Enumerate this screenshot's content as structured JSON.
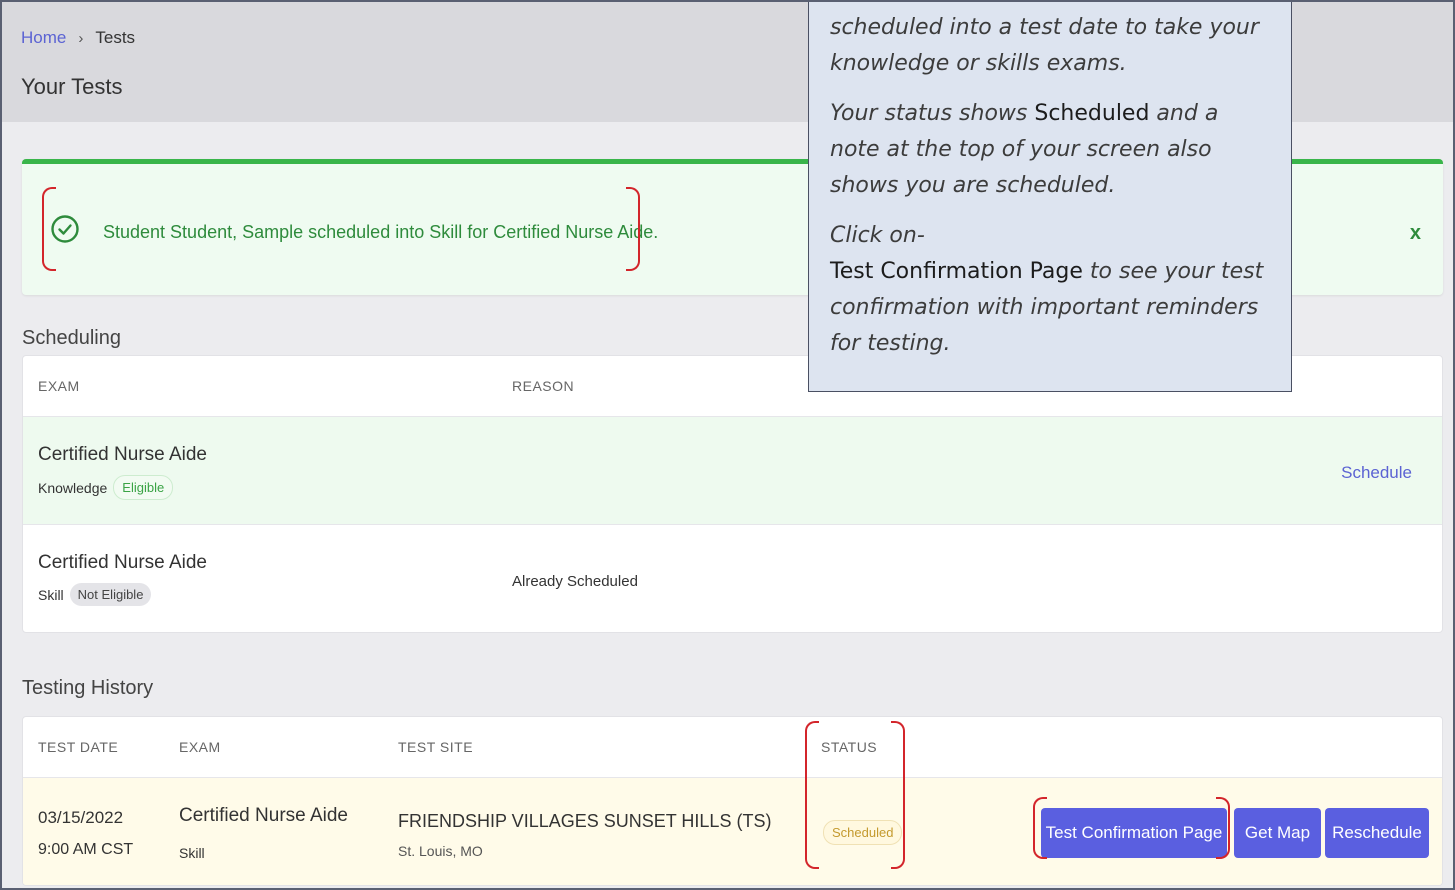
{
  "breadcrumb": {
    "home": "Home",
    "separator": "›",
    "current": "Tests"
  },
  "page_title": "Your Tests",
  "alert": {
    "message": "Student Student, Sample scheduled into Skill for Certified Nurse Aide.",
    "close": "x",
    "icon": "check-circle-icon",
    "color": "#39b54a"
  },
  "scheduling": {
    "label": "Scheduling",
    "headers": {
      "exam": "EXAM",
      "reason": "REASON"
    },
    "rows": [
      {
        "exam": "Certified Nurse Aide",
        "type": "Knowledge",
        "badge": "Eligible",
        "reason": "",
        "action": "Schedule"
      },
      {
        "exam": "Certified Nurse Aide",
        "type": "Skill",
        "badge": "Not Eligible",
        "reason": "Already Scheduled",
        "action": ""
      }
    ]
  },
  "history": {
    "label": "Testing History",
    "headers": {
      "date": "TEST DATE",
      "exam": "EXAM",
      "site": "TEST SITE",
      "status": "STATUS"
    },
    "rows": [
      {
        "date": "03/15/2022",
        "time": "9:00 AM CST",
        "exam": "Certified Nurse Aide",
        "exam_type": "Skill",
        "site": "FRIENDSHIP VILLAGES SUNSET HILLS (TS)",
        "site_location": "St. Louis, MO",
        "status": "Scheduled",
        "buttons": {
          "confirmation": "Test Confirmation Page",
          "map": "Get Map",
          "reschedule": "Reschedule"
        }
      }
    ]
  },
  "callout": {
    "line1": "scheduled into a test date to take your knowledge or skills exams.",
    "status_pre": "Your status shows ",
    "status_word": "Scheduled",
    "status_post": " and a note at the top of your screen also shows you are scheduled.",
    "click": "Click on-",
    "page_name": "Test Confirmation Page",
    "page_post": " to see your test confirmation with important reminders for testing."
  },
  "colors": {
    "accent": "#5a5fe0",
    "link": "#5b63d3",
    "success": "#39b54a",
    "annotation": "#d3252b"
  }
}
